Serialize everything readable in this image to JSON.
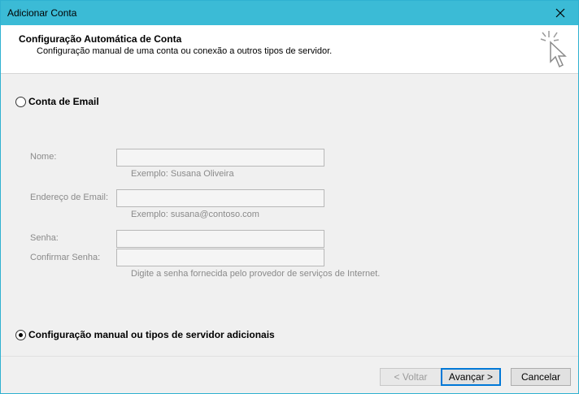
{
  "window": {
    "title": "Adicionar Conta"
  },
  "header": {
    "title": "Configuração Automática de Conta",
    "subtitle": "Configuração manual de uma conta ou conexão a outros tipos de servidor."
  },
  "options": {
    "email_account": {
      "label": "Conta de Email",
      "selected": false
    },
    "manual": {
      "label": "Configuração manual ou tipos de servidor adicionais",
      "selected": true
    }
  },
  "form": {
    "name_label": "Nome:",
    "name_value": "",
    "name_hint": "Exemplo: Susana Oliveira",
    "email_label": "Endereço de Email:",
    "email_value": "",
    "email_hint": "Exemplo: susana@contoso.com",
    "password_label": "Senha:",
    "confirm_label": "Confirmar Senha:",
    "password_hint": "Digite a senha fornecida pelo provedor de serviços de Internet."
  },
  "buttons": {
    "back": "< Voltar",
    "next": "Avançar >",
    "cancel": "Cancelar"
  },
  "icons": {
    "close": "close-icon",
    "header": "cursor-click-icon"
  }
}
